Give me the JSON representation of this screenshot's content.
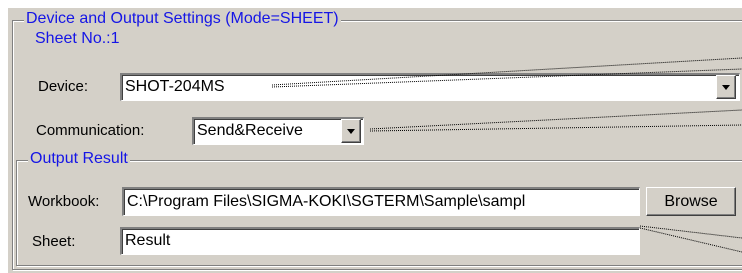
{
  "device_output_group": {
    "title": "Device and Output Settings (Mode=SHEET)",
    "sheet_no": "Sheet No.:1"
  },
  "device": {
    "label": "Device:",
    "value": "SHOT-204MS"
  },
  "communication": {
    "label": "Communication:",
    "value": "Send&Receive"
  },
  "output_result": {
    "title": "Output Result",
    "workbook_label": "Workbook:",
    "workbook_value": "C:\\Program Files\\SIGMA-KOKI\\SGTERM\\Sample\\sampl",
    "browse_label": "Browse",
    "sheet_label": "Sheet:",
    "sheet_value": "Result"
  },
  "icons": {
    "dropdown": "chevron-down-icon"
  }
}
